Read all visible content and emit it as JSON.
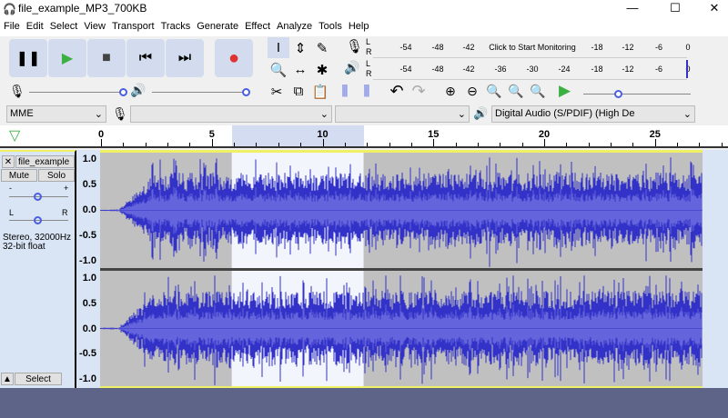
{
  "window": {
    "title": "file_example_MP3_700KB",
    "minimize": "—",
    "maximize": "☐",
    "close": "✕"
  },
  "menu": [
    "File",
    "Edit",
    "Select",
    "View",
    "Transport",
    "Tracks",
    "Generate",
    "Effect",
    "Analyze",
    "Tools",
    "Help"
  ],
  "transport": [
    {
      "name": "pause",
      "glyph": "❚❚",
      "color": "#000"
    },
    {
      "name": "play",
      "glyph": "▶",
      "color": "#3cb043"
    },
    {
      "name": "stop",
      "glyph": "■",
      "color": "#444"
    },
    {
      "name": "skip-start",
      "glyph": "⏮",
      "color": "#000"
    },
    {
      "name": "skip-end",
      "glyph": "⏭",
      "color": "#000"
    },
    {
      "name": "record",
      "glyph": "●",
      "color": "#e03030"
    }
  ],
  "tools": [
    {
      "name": "selection",
      "glyph": "I"
    },
    {
      "name": "envelope",
      "glyph": "⇕"
    },
    {
      "name": "draw",
      "glyph": "✎"
    },
    {
      "name": "zoom",
      "glyph": "🔍"
    },
    {
      "name": "time-shift",
      "glyph": "↔"
    },
    {
      "name": "multi",
      "glyph": "✱"
    }
  ],
  "meters": {
    "record_ticks": [
      "-54",
      "-48",
      "-42",
      "Click to Start Monitoring",
      "-18",
      "-12",
      "-6",
      "0"
    ],
    "play_ticks": [
      "-54",
      "-48",
      "-42",
      "-36",
      "-30",
      "-24",
      "-18",
      "-12",
      "-6",
      "0"
    ],
    "channels": [
      "L",
      "R"
    ]
  },
  "edit": [
    {
      "name": "cut",
      "glyph": "✂"
    },
    {
      "name": "copy",
      "glyph": "⧉"
    },
    {
      "name": "paste",
      "glyph": "📋"
    },
    {
      "name": "trim",
      "glyph": "⫼"
    },
    {
      "name": "silence",
      "glyph": "⫼"
    }
  ],
  "undo": [
    {
      "name": "undo",
      "glyph": "↶"
    },
    {
      "name": "redo",
      "glyph": "↷"
    }
  ],
  "zoomtools": [
    {
      "name": "zoom-in",
      "glyph": "⊕"
    },
    {
      "name": "zoom-out",
      "glyph": "⊖"
    },
    {
      "name": "fit-selection",
      "glyph": "🔍"
    },
    {
      "name": "fit-project",
      "glyph": "🔍"
    },
    {
      "name": "zoom-toggle",
      "glyph": "🔍"
    }
  ],
  "devices": {
    "host": "MME",
    "input": "",
    "channels": "",
    "output": "Digital Audio (S/PDIF) (High De"
  },
  "ruler": {
    "ticks": [
      "0",
      "5",
      "10",
      "15",
      "20",
      "25"
    ],
    "selection_start": 5.9,
    "selection_end": 11.85
  },
  "track": {
    "name": "file_example",
    "mute": "Mute",
    "solo": "Solo",
    "gain_minus": "-",
    "gain_plus": "+",
    "pan_left": "L",
    "pan_right": "R",
    "info1": "Stereo, 32000Hz",
    "info2": "32-bit float",
    "select": "Select",
    "collapse": "▲",
    "close": "✕",
    "menu": "▼",
    "vruler": [
      "1.0",
      "0.5",
      "0.0",
      "-0.5",
      "-1.0"
    ]
  },
  "colors": {
    "wave": "#3232c8",
    "rms": "#6464dc",
    "bg": "#c0c0c0",
    "selected_bg": "#ffffff",
    "focus": "#f0f064"
  }
}
